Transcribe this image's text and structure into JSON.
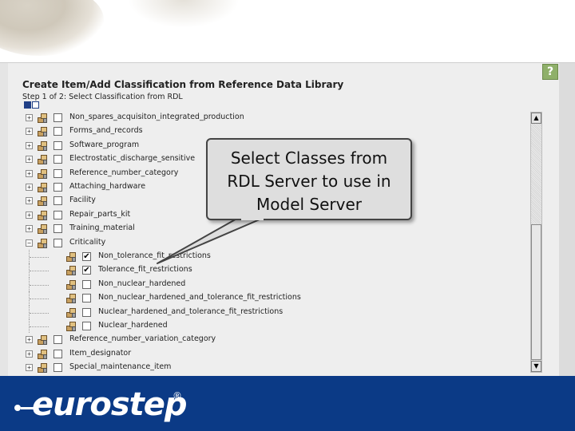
{
  "dialog": {
    "title": "Create Item/Add Classification from Reference Data Library",
    "step_label": "Step 1 of 2: Select Classification from RDL",
    "help_label": "?"
  },
  "tree": {
    "items": [
      {
        "label": "Non_spares_acquisiton_integrated_production",
        "level": 0,
        "expander": "+",
        "checked": false
      },
      {
        "label": "Forms_and_records",
        "level": 0,
        "expander": "+",
        "checked": false
      },
      {
        "label": "Software_program",
        "level": 0,
        "expander": "+",
        "checked": false
      },
      {
        "label": "Electrostatic_discharge_sensitive",
        "level": 0,
        "expander": "+",
        "checked": false
      },
      {
        "label": "Reference_number_category",
        "level": 0,
        "expander": "+",
        "checked": false
      },
      {
        "label": "Attaching_hardware",
        "level": 0,
        "expander": "+",
        "checked": false
      },
      {
        "label": "Facility",
        "level": 0,
        "expander": "+",
        "checked": false
      },
      {
        "label": "Repair_parts_kit",
        "level": 0,
        "expander": "+",
        "checked": false
      },
      {
        "label": "Training_material",
        "level": 0,
        "expander": "+",
        "checked": false
      },
      {
        "label": "Criticality",
        "level": 0,
        "expander": "−",
        "checked": false
      },
      {
        "label": "Non_tolerance_fit_restrictions",
        "level": 1,
        "expander": "",
        "checked": true
      },
      {
        "label": "Tolerance_fit_restrictions",
        "level": 1,
        "expander": "",
        "checked": true
      },
      {
        "label": "Non_nuclear_hardened",
        "level": 1,
        "expander": "",
        "checked": false
      },
      {
        "label": "Non_nuclear_hardened_and_tolerance_fit_restrictions",
        "level": 1,
        "expander": "",
        "checked": false
      },
      {
        "label": "Nuclear_hardened_and_tolerance_fit_restrictions",
        "level": 1,
        "expander": "",
        "checked": false
      },
      {
        "label": "Nuclear_hardened",
        "level": 1,
        "expander": "",
        "checked": false
      },
      {
        "label": "Reference_number_variation_category",
        "level": 0,
        "expander": "+",
        "checked": false
      },
      {
        "label": "Item_designator",
        "level": 0,
        "expander": "+",
        "checked": false
      },
      {
        "label": "Special_maintenance_item",
        "level": 0,
        "expander": "+",
        "checked": false
      }
    ]
  },
  "scrollbar": {
    "up_glyph": "▲",
    "down_glyph": "▼"
  },
  "callout": {
    "text_line1": "Select Classes from",
    "text_line2": "RDL Server to use in",
    "text_line3": "Model Server"
  },
  "footer": {
    "logo_text": "eurostep",
    "logo_mark": "®"
  },
  "colors": {
    "footer_bg": "#0b3a86",
    "help_icon_bg": "#8fb06a",
    "step_indicator": "#1f3f86"
  },
  "icons": {
    "help": "help-icon",
    "tree_node": "classification-node-icon",
    "expander": "tree-expander-icon"
  }
}
